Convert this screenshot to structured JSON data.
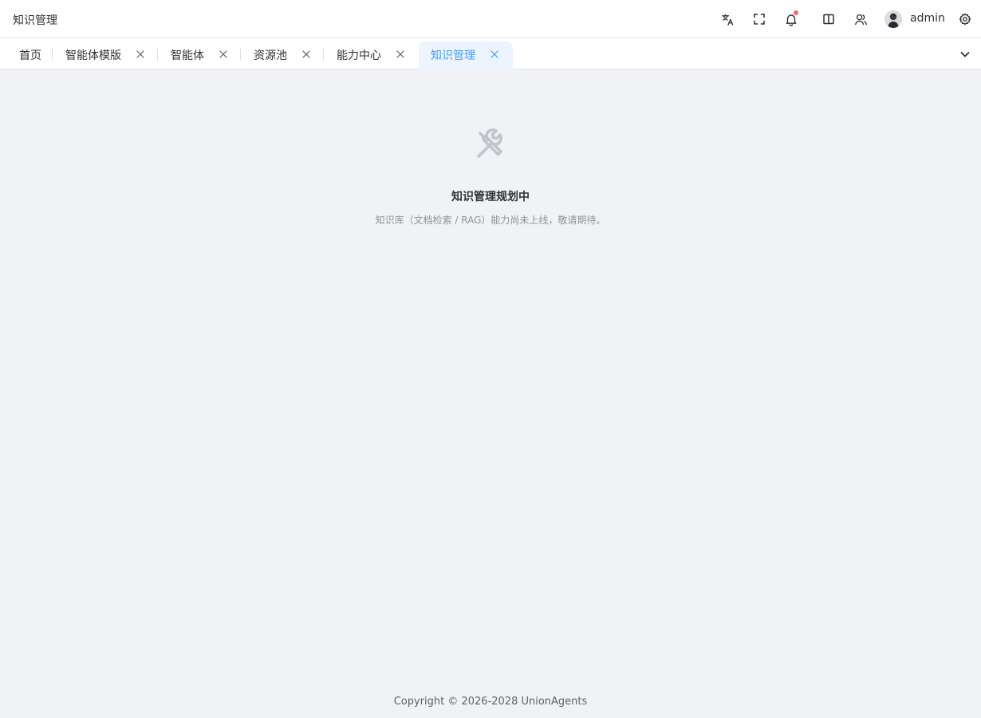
{
  "header": {
    "page_title": "知识管理",
    "username": "admin",
    "icons": [
      "translate-icon",
      "fullscreen-icon",
      "bell-icon",
      "book-icon",
      "users-icon",
      "settings-icon"
    ],
    "notification_dot_color": "#f56c6c"
  },
  "tabs": [
    {
      "label": "首页",
      "closable": false,
      "active": false
    },
    {
      "label": "智能体模版",
      "closable": true,
      "active": false
    },
    {
      "label": "智能体",
      "closable": true,
      "active": false
    },
    {
      "label": "资源池",
      "closable": true,
      "active": false
    },
    {
      "label": "能力中心",
      "closable": true,
      "active": false
    },
    {
      "label": "知识管理",
      "closable": true,
      "active": true
    }
  ],
  "empty_state": {
    "icon": "tools-icon",
    "title": "知识管理规划中",
    "description": "知识库（文档检索 / RAG）能力尚未上线，敬请期待。"
  },
  "footer": {
    "copyright": "Copyright © 2026-2028 UnionAgents"
  },
  "colors": {
    "accent": "#409eff",
    "active_tab_bg": "#ecf5ff",
    "page_bg": "#f0f2f5"
  }
}
